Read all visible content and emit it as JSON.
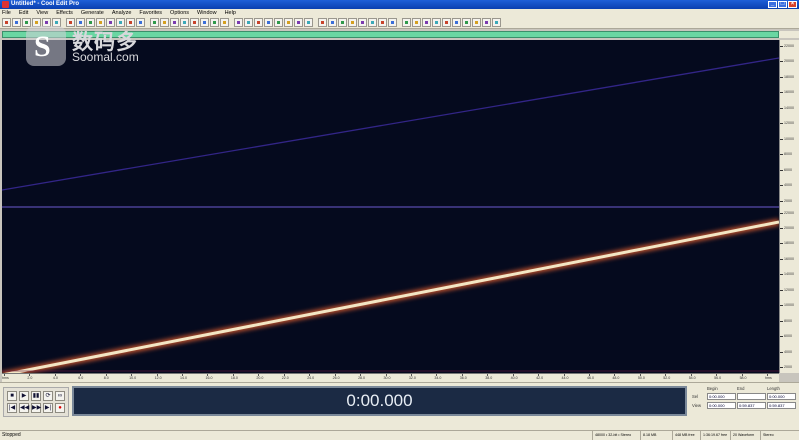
{
  "window": {
    "title": "Untitled* - Cool Edit Pro",
    "minimize": "_",
    "maximize": "□",
    "close": "×"
  },
  "menu": [
    "File",
    "Edit",
    "View",
    "Effects",
    "Generate",
    "Analyze",
    "Favorites",
    "Options",
    "Window",
    "Help"
  ],
  "toolbar": {
    "button_count": 48,
    "colors": [
      "#c8432b",
      "#3a6ed8",
      "#2f9a4a",
      "#d4a020",
      "#7a3ab0",
      "#3aa9b8"
    ]
  },
  "spectrogram": {
    "background": "#050a1e",
    "sweep_color": "#f3e6c4",
    "glow_color": "#ff6a30",
    "upper_line_color": "#3a2a9a",
    "divider_color": "#6a5acd"
  },
  "right_scale": {
    "labels": [
      "22000",
      "20000",
      "18000",
      "16000",
      "14000",
      "12000",
      "10000",
      "8000",
      "6000",
      "4000",
      "2000",
      "22000",
      "20000",
      "18000",
      "16000",
      "14000",
      "12000",
      "10000",
      "8000",
      "6000",
      "4000",
      "2000"
    ]
  },
  "timeline": {
    "labels": [
      "hms",
      "2.0",
      "4.0",
      "6.0",
      "8.0",
      "10.0",
      "12.0",
      "14.0",
      "16.0",
      "18.0",
      "20.0",
      "22.0",
      "24.0",
      "26.0",
      "28.0",
      "30.0",
      "32.0",
      "34.0",
      "36.0",
      "38.0",
      "40.0",
      "42.0",
      "44.0",
      "46.0",
      "48.0",
      "50.0",
      "52.0",
      "54.0",
      "56.0",
      "58.0",
      "hms"
    ]
  },
  "transport": {
    "buttons_row1": [
      "■",
      "▶",
      "▮▮",
      "⟳",
      "∞"
    ],
    "buttons_row2": [
      "|◀",
      "◀◀",
      "▶▶",
      "▶|",
      "●"
    ]
  },
  "time_display": "0:00.000",
  "selection": {
    "headers": [
      "Begin",
      "End",
      "Length"
    ],
    "rows": [
      {
        "label": "Sel",
        "values": [
          "0:00.000",
          "",
          "0:00.000"
        ]
      },
      {
        "label": "View",
        "values": [
          "0:00.000",
          "0:59.837",
          "0:59.837"
        ]
      }
    ]
  },
  "status": {
    "left": "Stopped",
    "items": [
      "48000 • 32-bit • Stereo",
      "8.18 MB",
      "448 MB free",
      "1:36:19.67 free",
      "20 Waveform",
      "Stereo"
    ]
  },
  "watermark": {
    "logo_letter": "S",
    "chinese": "数码多",
    "english": "Soomal.com"
  }
}
